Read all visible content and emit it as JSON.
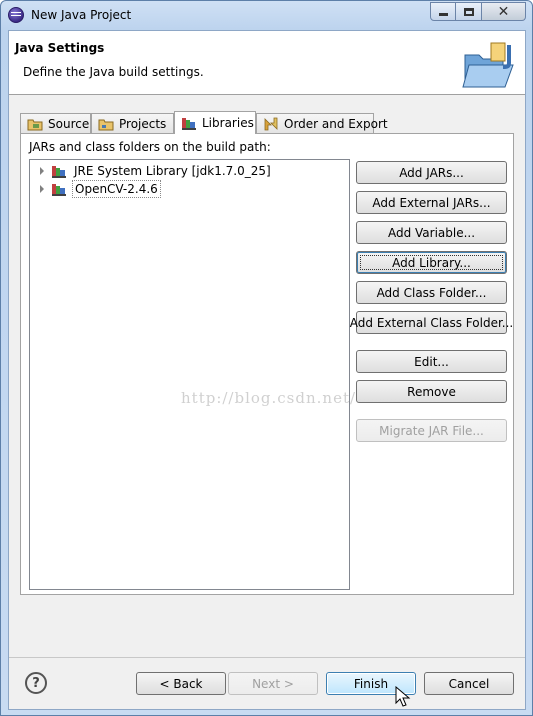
{
  "window": {
    "title": "New Java Project"
  },
  "header": {
    "title": "Java Settings",
    "description": "Define the Java build settings."
  },
  "tabs": [
    {
      "label": "Source",
      "icon": "source-icon"
    },
    {
      "label": "Projects",
      "icon": "projects-icon"
    },
    {
      "label": "Libraries",
      "icon": "libraries-icon",
      "active": true
    },
    {
      "label": "Order and Export",
      "icon": "order-export-icon"
    }
  ],
  "panel": {
    "label": "JARs and class folders on the build path:",
    "tree": [
      {
        "label": "JRE System Library [jdk1.7.0_25]"
      },
      {
        "label": "OpenCV-2.4.6",
        "selected": true
      }
    ]
  },
  "buttons": {
    "add_jars": "Add JARs...",
    "add_external_jars": "Add External JARs...",
    "add_variable": "Add Variable...",
    "add_library": "Add Library...",
    "add_class_folder": "Add Class Folder...",
    "add_external_class_folder": "Add External Class Folder...",
    "edit": "Edit...",
    "remove": "Remove",
    "migrate_jar": "Migrate JAR File..."
  },
  "watermark": "http://blog.csdn.net/",
  "footer": {
    "help": "?",
    "back": "< Back",
    "next": "Next >",
    "finish": "Finish",
    "cancel": "Cancel"
  },
  "colors": {
    "accent": "#3c7fb1",
    "window_frame": "#bcd3ee"
  }
}
